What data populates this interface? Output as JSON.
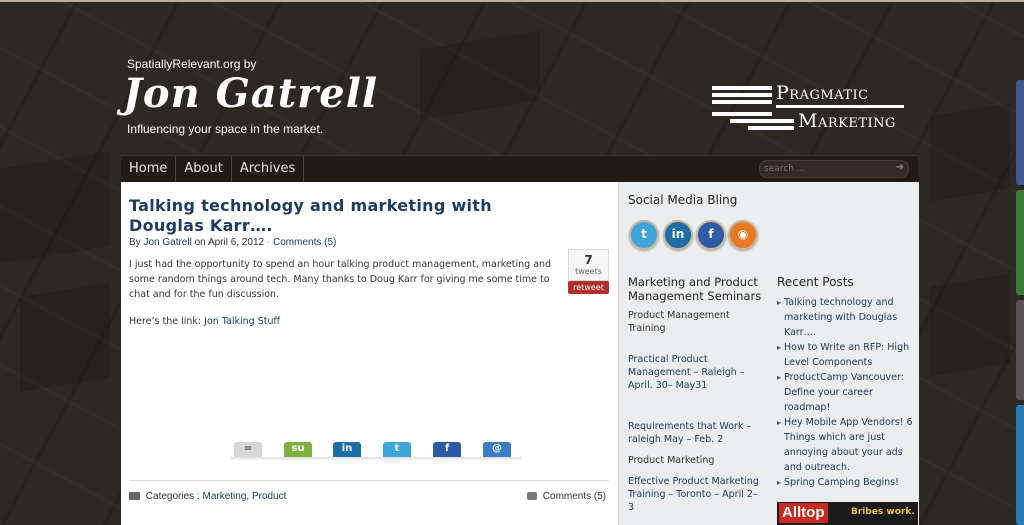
{
  "header": {
    "byline": "SpatiallyRelevant.org by",
    "name": "Jon Gatrell",
    "tagline": "Influencing your space in the market.",
    "logo_word1": "Pragmatic",
    "logo_word2": "Marketing"
  },
  "nav": {
    "items": [
      "Home",
      "About",
      "Archives"
    ],
    "search_placeholder": "search ..."
  },
  "post": {
    "title": "Talking technology and marketing with Douglas Karr….",
    "meta_prefix": "By",
    "author": "Jon Gatrell",
    "meta_on": "on April 6, 2012",
    "meta_sep": "·",
    "comments_link": "Comments (5)",
    "body": "I just had the opportunity to spend an hour talking product management, marketing and some random things around tech.  Many thanks to Doug Karr for giving me some time to chat and for the fun discussion.",
    "link_prefix": "Here’s the link:",
    "link_text": "Jon Talking Stuff",
    "tweet_count": "7",
    "tweet_label": "tweets",
    "retweet_label": "retweet",
    "categories_label": "Categories :",
    "categories": [
      "Marketing",
      "Product"
    ],
    "comments_footer": "Comments (5)"
  },
  "share_icons": [
    "delicious-icon",
    "stumbleupon-icon",
    "linkedin-icon",
    "twitter-icon",
    "facebook-icon",
    "email-icon"
  ],
  "sidebar": {
    "social_title": "Social Media Bling",
    "social_icons": [
      "twitter-icon",
      "linkedin-icon",
      "facebook-icon",
      "rss-icon"
    ],
    "seminars_title": "Marketing and Product Management Seminars",
    "seminars": [
      {
        "text": "Product Management Training",
        "link": false
      },
      {
        "text": "Practical Product Management – Raleigh – April. 30– May31",
        "link": true
      },
      {
        "text": "Requirements that Work – raleigh May – Feb. 2",
        "link": true
      },
      {
        "text": "Product Marketing",
        "link": false
      },
      {
        "text": "Effective Product Marketing Training – Toronto – April 2–3",
        "link": true
      }
    ],
    "recent_title": "Recent Posts",
    "recent": [
      "Talking technology and marketing with Douglas Karr….",
      "How to Write an RFP: High Level Components",
      "ProductCamp Vancouver: Define your career roadmap!",
      "Hey Mobile App Vendors! 6 Things which are just annoying about your ads and outreach.",
      "Spring Camping Begins!"
    ],
    "ad_brand": "Alltop",
    "ad_tag": "Bribes work."
  },
  "colors": {
    "background": "#2c2824",
    "link": "#1d3b63",
    "retweet": "#b0302e",
    "twitter": "#3fa4d8",
    "linkedin": "#1b6ea8",
    "facebook": "#2e5aa6",
    "rss": "#e67a25"
  }
}
